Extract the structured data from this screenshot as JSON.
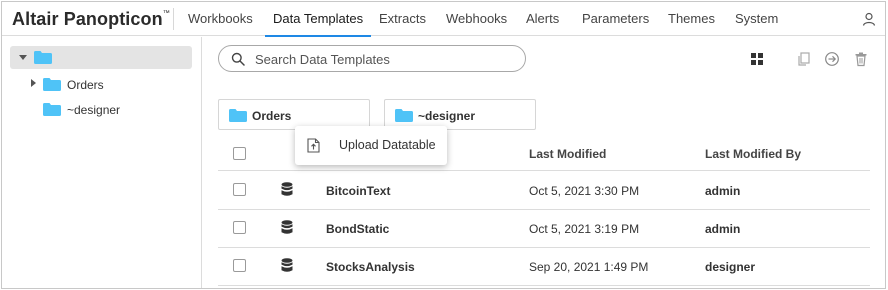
{
  "app": {
    "brand": "Altair Panopticon",
    "brand_mark": "™"
  },
  "nav": {
    "tabs": [
      {
        "label": "Workbooks"
      },
      {
        "label": "Data Templates",
        "active": true
      },
      {
        "label": "Extracts"
      },
      {
        "label": "Webhooks"
      },
      {
        "label": "Alerts"
      },
      {
        "label": "Parameters"
      },
      {
        "label": "Themes"
      },
      {
        "label": "System"
      }
    ],
    "user_icon": "user-icon"
  },
  "tree": {
    "root_label": "",
    "items": [
      {
        "label": "Orders",
        "expandable": true
      },
      {
        "label": "~designer",
        "expandable": false
      }
    ]
  },
  "search": {
    "placeholder": "Search Data Templates"
  },
  "toolbar": {
    "icons": [
      "grid-view-icon",
      "copy-icon",
      "move-icon",
      "delete-icon"
    ]
  },
  "folders": [
    {
      "label": "Orders"
    },
    {
      "label": "~designer"
    }
  ],
  "context_menu": {
    "items": [
      {
        "label": "Upload Datatable",
        "icon": "upload-file-icon"
      }
    ]
  },
  "table": {
    "columns": {
      "name": "",
      "last_modified": "Last Modified",
      "last_modified_by": "Last Modified By"
    },
    "rows": [
      {
        "name": "BitcoinText",
        "last_modified": "Oct 5, 2021 3:30 PM",
        "last_modified_by": "admin"
      },
      {
        "name": "BondStatic",
        "last_modified": "Oct 5, 2021 3:19 PM",
        "last_modified_by": "admin"
      },
      {
        "name": "StocksAnalysis",
        "last_modified": "Sep 20, 2021 1:49 PM",
        "last_modified_by": "designer"
      }
    ]
  },
  "colors": {
    "accent": "#1e88e5",
    "folder": "#4fc3f7"
  }
}
